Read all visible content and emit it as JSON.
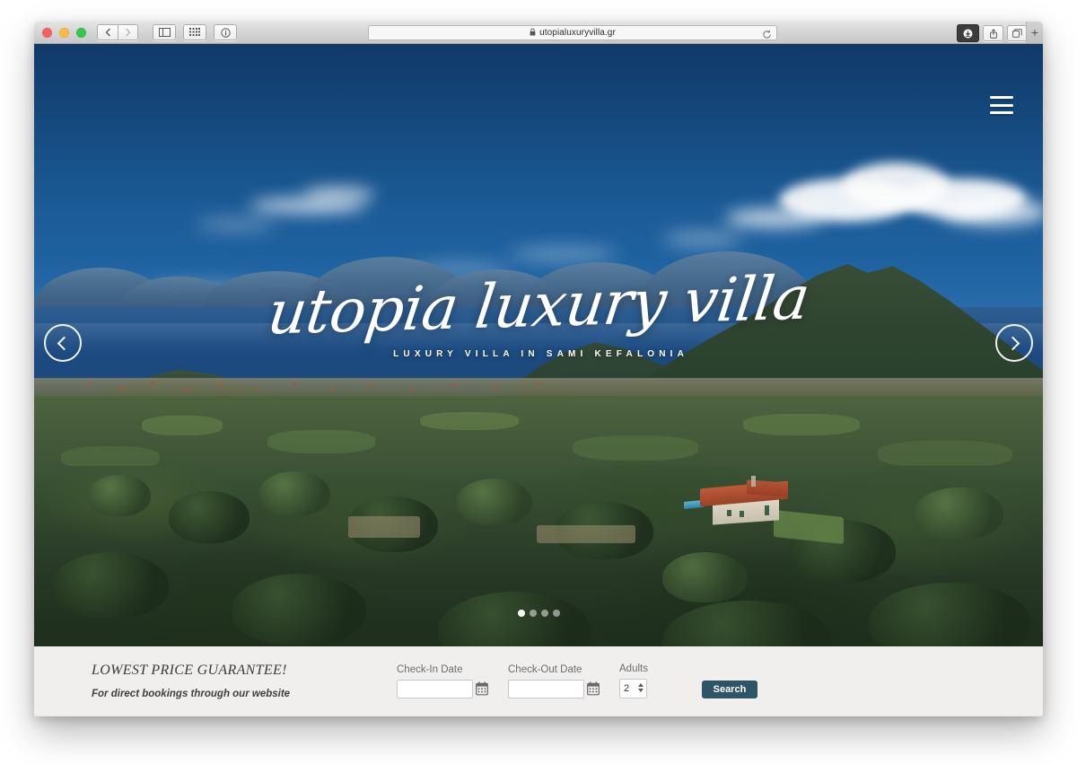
{
  "browser": {
    "url": "utopialuxuryvilla.gr",
    "secure_icon": "lock-icon",
    "traffic_lights": [
      "close-button",
      "minimize-button",
      "maximize-button"
    ],
    "back_icon": "chevron-left-icon",
    "forward_icon": "chevron-right-icon",
    "sidebar_icon": "sidebar-icon",
    "top_sites_icon": "grid-icon",
    "reader_icon": "info-icon",
    "reload_icon": "reload-icon",
    "downloads_icon": "download-icon",
    "share_icon": "share-icon",
    "tabs_icon": "tabs-icon",
    "new_tab_label": "+"
  },
  "hero": {
    "title": "utopia luxury villa",
    "subtitle": "LUXURY VILLA IN SAMI KEFALONIA",
    "menu_icon": "hamburger-menu-icon",
    "prev_icon": "chevron-left-icon",
    "next_icon": "chevron-right-icon",
    "slides": [
      {
        "index": 1,
        "active": true
      },
      {
        "index": 2,
        "active": false
      },
      {
        "index": 3,
        "active": false
      },
      {
        "index": 4,
        "active": false
      }
    ]
  },
  "booking": {
    "promo_title": "LOWEST PRICE GUARANTEE!",
    "promo_subtitle": "For direct bookings through our website",
    "checkin_label": "Check-In Date",
    "checkin_value": "",
    "checkout_label": "Check-Out Date",
    "checkout_value": "",
    "adults_label": "Adults",
    "adults_value": "2",
    "search_label": "Search",
    "calendar_icon": "calendar-icon",
    "search_button_color": "#2f5468"
  },
  "colors": {
    "booking_bg": "#f0efee",
    "accent": "#2f5468",
    "sky_top": "#123f74",
    "sea": "#1c4a80",
    "forest": "#2a3d28"
  }
}
